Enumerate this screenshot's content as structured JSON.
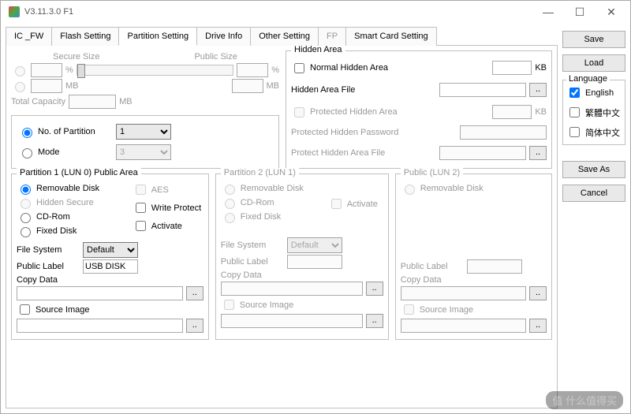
{
  "title": "V3.11.3.0 F1",
  "tabs": [
    "IC _FW",
    "Flash Setting",
    "Partition Setting",
    "Drive Info",
    "Other Setting",
    "FP",
    "Smart Card Setting"
  ],
  "activeTab": 2,
  "sidebar": {
    "save": "Save",
    "load": "Load",
    "saveAs": "Save As",
    "cancel": "Cancel",
    "langLegend": "Language",
    "langs": [
      "English",
      "繁體中文",
      "简体中文"
    ]
  },
  "sizes": {
    "secure": "Secure Size",
    "public": "Public Size",
    "pct": "%",
    "mb": "MB",
    "total": "Total Capacity"
  },
  "partSel": {
    "num": "No. of Partition",
    "numVal": "1",
    "mode": "Mode",
    "modeVal": "3"
  },
  "hidden": {
    "legend": "Hidden Area",
    "normal": "Normal Hidden Area",
    "kb": "KB",
    "file": "Hidden Area File",
    "protected": "Protected Hidden Area",
    "pwd": "Protected Hidden Password",
    "pfile": "Protect Hidden Area File"
  },
  "p1": {
    "legend": "Partition 1 (LUN 0) Public Area",
    "removable": "Removable Disk",
    "hiddenSecure": "Hidden Secure",
    "cdrom": "CD-Rom",
    "fixed": "Fixed Disk",
    "aes": "AES",
    "wp": "Write Protect",
    "activate": "Activate",
    "fs": "File System",
    "fsVal": "Default",
    "label": "Public Label",
    "labelVal": "USB DISK",
    "copy": "Copy Data",
    "src": "Source Image"
  },
  "p2": {
    "legend": "Partition 2 (LUN 1)",
    "removable": "Removable Disk",
    "cdrom": "CD-Rom",
    "fixed": "Fixed Disk",
    "activate": "Activate",
    "fs": "File System",
    "fsVal": "Default",
    "label": "Public Label",
    "copy": "Copy Data",
    "src": "Source Image"
  },
  "p3": {
    "legend": "Public (LUN 2)",
    "removable": "Removable Disk",
    "label": "Public Label",
    "copy": "Copy Data",
    "src": "Source Image"
  },
  "watermark": "值 什么值得买"
}
